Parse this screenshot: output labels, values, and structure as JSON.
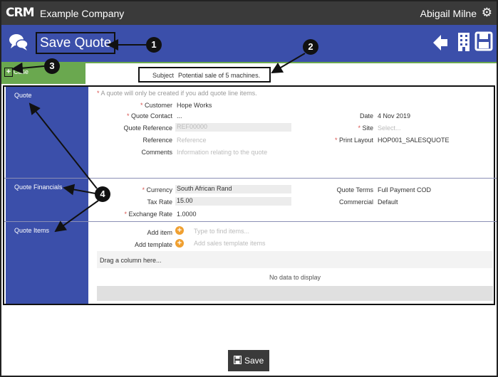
{
  "header": {
    "logo": "CRM",
    "company": "Example Company",
    "user": "Abigail Milne",
    "settings_icon": "gear-icon"
  },
  "titlebar": {
    "title": "Save Quote",
    "icons": [
      "chat-icon",
      "back-arrow-icon",
      "building-icon",
      "save-icon"
    ]
  },
  "case": {
    "toggle": "+",
    "label": "Case",
    "subject_label": "Subject",
    "subject_value": "Potential sale of 5 machines."
  },
  "quote": {
    "section_label": "Quote",
    "note_star": "*",
    "note": "A quote will only be created if you add quote line items.",
    "customer_label": "Customer",
    "customer_value": "Hope Works",
    "contact_label": "Quote Contact",
    "contact_value": "...",
    "reference_label": "Quote Reference",
    "reference_placeholder": "REF00000",
    "ref_label": "Reference",
    "ref_placeholder": "Reference",
    "comments_label": "Comments",
    "comments_placeholder": "Information relating to the quote",
    "date_label": "Date",
    "date_value": "4 Nov 2019",
    "site_label": "Site",
    "site_placeholder": "Select...",
    "layout_label": "Print Layout",
    "layout_value": "HOP001_SALESQUOTE"
  },
  "financials": {
    "section_label": "Quote Financials",
    "currency_label": "Currency",
    "currency_value": "South African Rand",
    "tax_label": "Tax Rate",
    "tax_value": "15.00",
    "exchange_label": "Exchange Rate",
    "exchange_value": "1.0000",
    "terms_label": "Quote Terms",
    "terms_value": "Full Payment COD",
    "commercial_label": "Commercial",
    "commercial_value": "Default"
  },
  "items": {
    "section_label": "Quote Items",
    "add_item_label": "Add item",
    "add_item_placeholder": "Type to find items...",
    "add_template_label": "Add template",
    "add_template_placeholder": "Add sales template items",
    "grid_group_hint": "Drag a column here...",
    "grid_empty": "No data to display"
  },
  "callouts": [
    "1",
    "2",
    "3",
    "4"
  ],
  "footer": {
    "save_label": "Save"
  }
}
